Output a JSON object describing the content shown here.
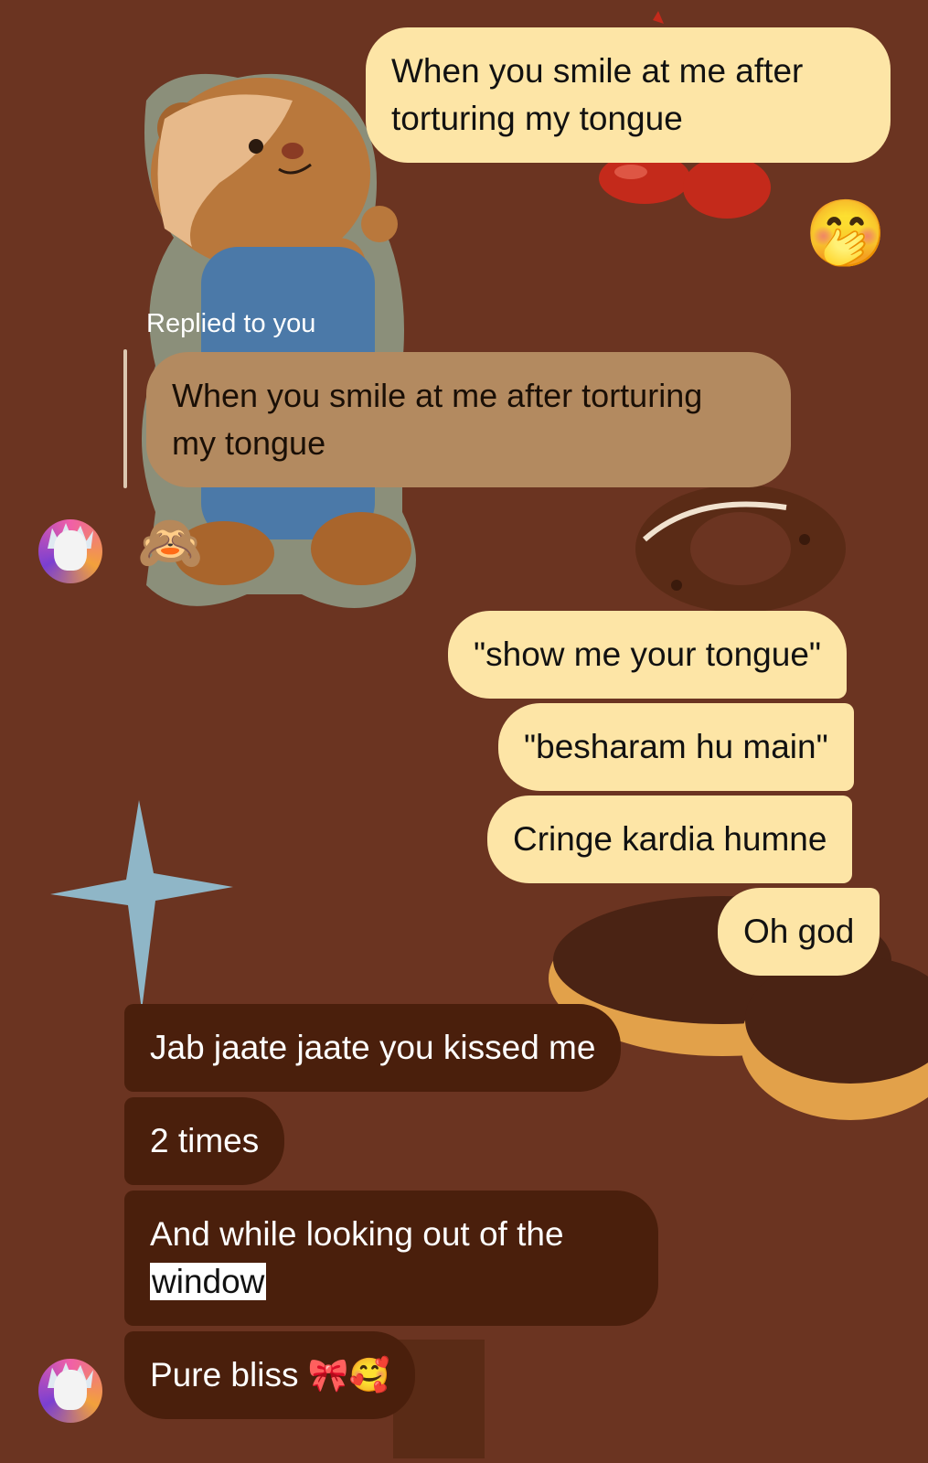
{
  "messages": {
    "top_outgoing": "When you smile at me after torturing my tongue",
    "top_outgoing_l1": "When you smile at me after",
    "top_outgoing_l2": "torturing my tongue",
    "top_emoji": "🤭",
    "reply_label": "Replied to you",
    "reply_quote_l1": "When you smile at me after torturing",
    "reply_quote_l2": "my tongue",
    "reply_emoji": "🙈",
    "out_1": "\"show me your tongue\"",
    "out_2": "\"besharam hu main\"",
    "out_3": "Cringe kardia humne",
    "out_4": "Oh god",
    "in_1": "Jab jaate jaate you kissed me",
    "in_2": "2 times",
    "in_3_l1": "And while looking out of the",
    "in_3_highlight": "window",
    "in_4_text": "Pure bliss",
    "in_4_emoji": "🎀🥰"
  },
  "colors": {
    "background": "#6b3421",
    "outgoing_bubble": "#fde5a6",
    "incoming_bubble": "#4a1f0c",
    "reply_bubble": "#b38a60"
  },
  "icons": {
    "avatar": "rick-avatar-icon",
    "sticker_bear": "teddy-bear-sticker",
    "sticker_star": "sparkle-star-sticker",
    "sticker_donut": "donut-sticker",
    "sticker_berries": "berries-sticker"
  }
}
